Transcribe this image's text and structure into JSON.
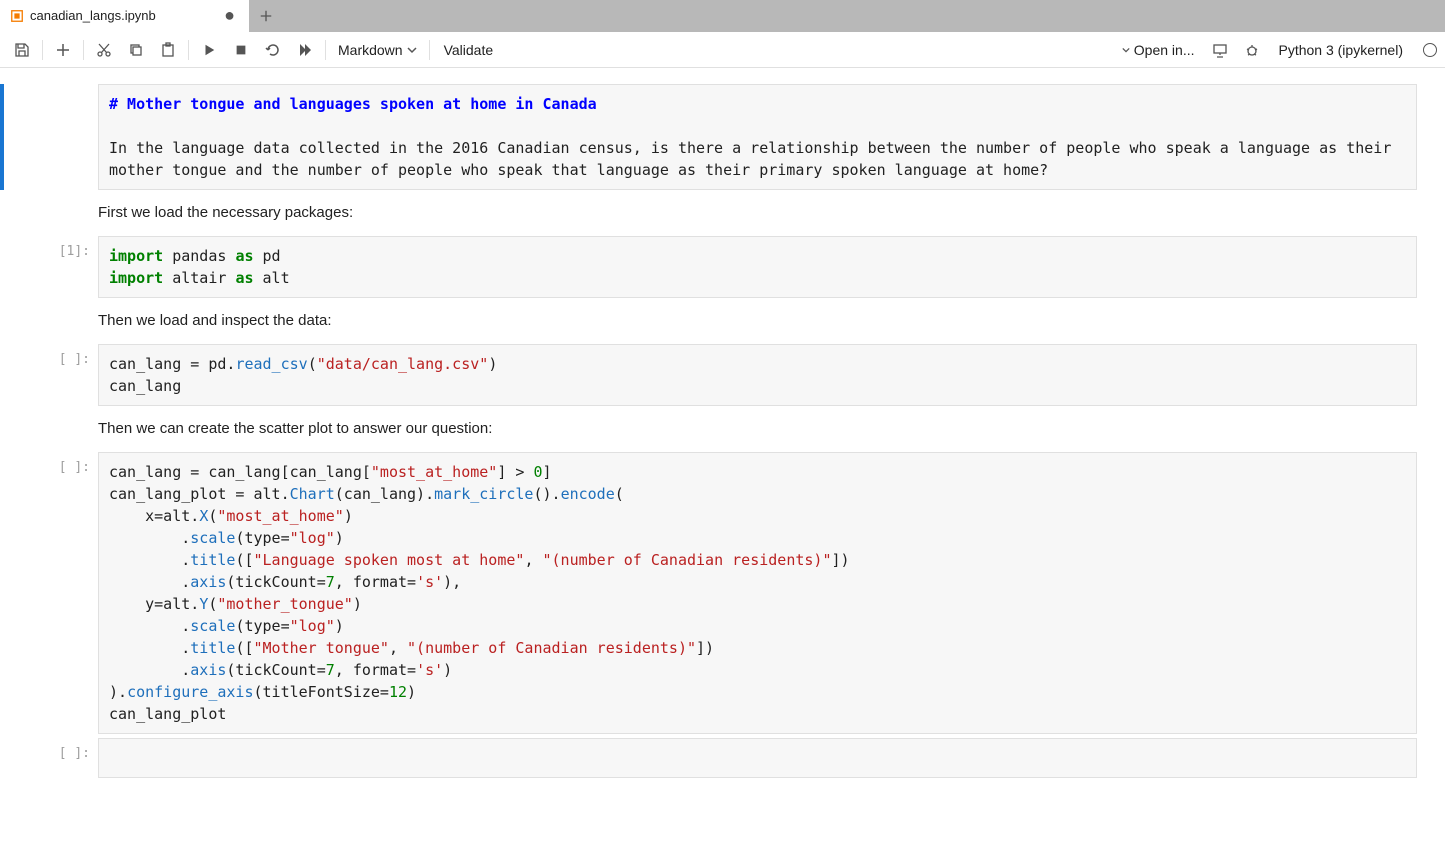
{
  "tab": {
    "title": "canadian_langs.ipynb"
  },
  "toolbar": {
    "cell_type": "Markdown",
    "validate": "Validate",
    "open_in": "Open in...",
    "kernel": "Python 3 (ipykernel)"
  },
  "cells": {
    "c0": {
      "prompt": "",
      "md_heading": "# Mother tongue and languages spoken at home in Canada",
      "md_body": "In the language data collected in the 2016 Canadian census, is there a relationship between the number of people who speak a language as their mother tongue and the number of people who speak that language as their primary spoken language at home?"
    },
    "c1_md": "First we load the necessary packages:",
    "c2": {
      "prompt": "[1]:",
      "code": {
        "l1_kw": "import",
        "l1_mod": " pandas ",
        "l1_as": "as",
        "l1_alias": " pd",
        "l2_kw": "import",
        "l2_mod": " altair ",
        "l2_as": "as",
        "l2_alias": " alt"
      }
    },
    "c3_md": "Then we load and inspect the data:",
    "c4": {
      "prompt": "[ ]:",
      "code": {
        "l1a": "can_lang = pd.",
        "l1b": "read_csv",
        "l1c": "(",
        "l1d": "\"data/can_lang.csv\"",
        "l1e": ")",
        "l2": "can_lang"
      }
    },
    "c5_md": "Then we can create the scatter plot to answer our question:",
    "c6": {
      "prompt": "[ ]:",
      "code": {
        "l1a": "can_lang = can_lang[can_lang[",
        "l1b": "\"most_at_home\"",
        "l1c": "] > ",
        "l1d": "0",
        "l1e": "]",
        "l2a": "can_lang_plot = alt.",
        "l2b": "Chart",
        "l2c": "(can_lang).",
        "l2d": "mark_circle",
        "l2e": "().",
        "l2f": "encode",
        "l2g": "(",
        "l3a": "    x=alt.",
        "l3b": "X",
        "l3c": "(",
        "l3d": "\"most_at_home\"",
        "l3e": ")",
        "l4a": "        .",
        "l4b": "scale",
        "l4c": "(type=",
        "l4d": "\"log\"",
        "l4e": ")",
        "l5a": "        .",
        "l5b": "title",
        "l5c": "([",
        "l5d": "\"Language spoken most at home\"",
        "l5e": ", ",
        "l5f": "\"(number of Canadian residents)\"",
        "l5g": "])",
        "l6a": "        .",
        "l6b": "axis",
        "l6c": "(tickCount=",
        "l6d": "7",
        "l6e": ", format=",
        "l6f": "'s'",
        "l6g": "),",
        "l7a": "    y=alt.",
        "l7b": "Y",
        "l7c": "(",
        "l7d": "\"mother_tongue\"",
        "l7e": ")",
        "l8a": "        .",
        "l8b": "scale",
        "l8c": "(type=",
        "l8d": "\"log\"",
        "l8e": ")",
        "l9a": "        .",
        "l9b": "title",
        "l9c": "([",
        "l9d": "\"Mother tongue\"",
        "l9e": ", ",
        "l9f": "\"(number of Canadian residents)\"",
        "l9g": "])",
        "l10a": "        .",
        "l10b": "axis",
        "l10c": "(tickCount=",
        "l10d": "7",
        "l10e": ", format=",
        "l10f": "'s'",
        "l10g": ")",
        "l11a": ").",
        "l11b": "configure_axis",
        "l11c": "(titleFontSize=",
        "l11d": "12",
        "l11e": ")",
        "l12": "can_lang_plot"
      }
    },
    "c7": {
      "prompt": "[ ]:"
    }
  }
}
